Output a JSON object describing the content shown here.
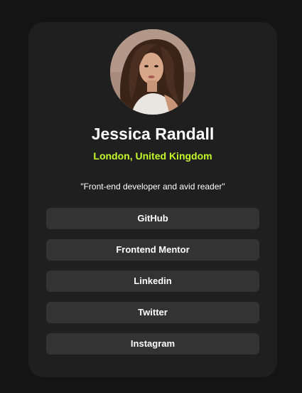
{
  "profile": {
    "name": "Jessica Randall",
    "location": "London, United Kingdom",
    "bio": "\"Front-end developer and avid reader\""
  },
  "links": [
    {
      "label": "GitHub"
    },
    {
      "label": "Frontend Mentor"
    },
    {
      "label": "Linkedin"
    },
    {
      "label": "Twitter"
    },
    {
      "label": "Instagram"
    }
  ],
  "colors": {
    "page_background": "#141414",
    "card_background": "#1f1f1f",
    "button_background": "#333333",
    "accent_green": "#c4f82a",
    "text_white": "#ffffff"
  }
}
